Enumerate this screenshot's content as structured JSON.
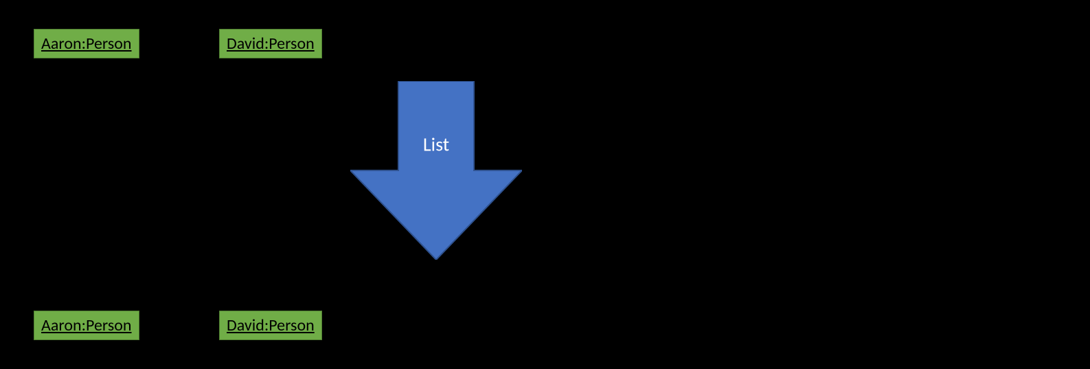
{
  "colors": {
    "box_fill": "#70ad47",
    "box_border": "#507e32",
    "arrow_fill": "#4472c4",
    "arrow_border": "#2f528f",
    "background": "#000000"
  },
  "top_boxes": [
    {
      "label": "Aaron:Person"
    },
    {
      "label": "David:Person"
    }
  ],
  "bottom_boxes": [
    {
      "label": "Aaron:Person"
    },
    {
      "label": "David:Person"
    }
  ],
  "arrow": {
    "label": "List"
  }
}
